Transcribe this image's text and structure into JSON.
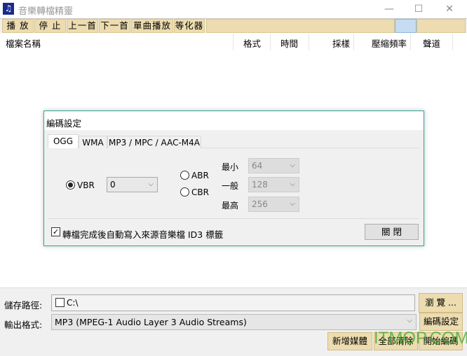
{
  "window": {
    "title": "音樂轉檔精靈",
    "icon": "music-note-icon",
    "minimize": "—",
    "maximize": "☐",
    "close": "✕"
  },
  "toolbar": {
    "buttons": [
      "播 放",
      "停 止",
      "上一首",
      "下一首",
      "單曲播放",
      "等化器"
    ]
  },
  "list": {
    "columns": [
      "檔案名稱",
      "格式",
      "時間",
      "採樣",
      "壓縮頻率",
      "聲道"
    ]
  },
  "bottom": {
    "save_path_label": "儲存路徑:",
    "save_path_value": "C:\\",
    "browse_button": "瀏 覽 ...",
    "output_format_label": "輸出格式:",
    "output_format_value": "MP3  (MPEG-1 Audio Layer 3 Audio Streams)",
    "encode_settings_button": "編碼設定",
    "add_media_button": "新增媒體",
    "clear_all_button": "全部清除",
    "start_encode_button": "開始編碼"
  },
  "dialog": {
    "title": "編碼設定",
    "tabs": [
      "OGG",
      "WMA",
      "MP3 / MPC / AAC-M4A"
    ],
    "active_tab": "OGG",
    "vbr_label": "VBR",
    "vbr_selected": true,
    "vbr_value": "0",
    "abr_label": "ABR",
    "cbr_label": "CBR",
    "min_label": "最小",
    "min_value": "64",
    "normal_label": "一般",
    "normal_value": "128",
    "max_label": "最高",
    "max_value": "256",
    "id3_checkbox_label": "轉檔完成後自動寫入來源音樂檔 ID3 標籤",
    "id3_checked": true,
    "close_button": "關 閉"
  },
  "watermark": "ITMOP.COM",
  "colors": {
    "toolbar": "#ecdcaf",
    "dialog_border": "#2fa89a",
    "toolbar_highlight": "#c5dcf2"
  }
}
